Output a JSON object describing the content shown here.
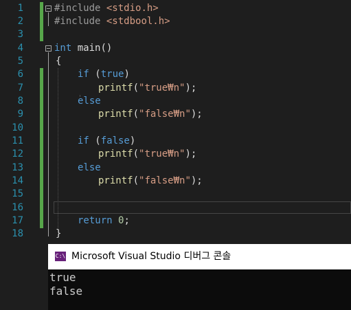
{
  "editor": {
    "line_numbers": [
      "1",
      "2",
      "3",
      "4",
      "5",
      "6",
      "7",
      "8",
      "9",
      "10",
      "11",
      "12",
      "13",
      "14",
      "15",
      "16",
      "17",
      "18"
    ],
    "lines": {
      "l1_directive": "#include",
      "l1_header": "<stdio.h>",
      "l2_directive": "#include",
      "l2_header": "<stdbool.h>",
      "l4_type": "int",
      "l4_name": "main",
      "l4_parens": "()",
      "l5_brace": "{",
      "l6_kw": "if",
      "l6_open": " (",
      "l6_cond": "true",
      "l6_close": ")",
      "l7_fn": "printf",
      "l7_open": "(",
      "l7_str": "\"true₩n\"",
      "l7_close": ");",
      "l8_kw": "else",
      "l9_fn": "printf",
      "l9_open": "(",
      "l9_str": "\"false₩n\"",
      "l9_close": ");",
      "l11_kw": "if",
      "l11_open": " (",
      "l11_cond": "false",
      "l11_close": ")",
      "l12_fn": "printf",
      "l12_open": "(",
      "l12_str": "\"true₩n\"",
      "l12_close": ");",
      "l13_kw": "else",
      "l14_fn": "printf",
      "l14_open": "(",
      "l14_str": "\"false₩n\"",
      "l14_close": ");",
      "l17_kw": "return",
      "l17_num": "0",
      "l17_semi": ";",
      "l18_brace": "}"
    }
  },
  "console": {
    "icon_label": "C:\\",
    "title": "Microsoft Visual Studio 디버그 콘솔",
    "output": [
      "true",
      "false"
    ]
  },
  "colors": {
    "background": "#1e1e1e",
    "line_number": "#2b91af",
    "keyword": "#569cd6",
    "string": "#d69d85",
    "function": "#dcdcaa",
    "change_bar": "#57a64a"
  }
}
